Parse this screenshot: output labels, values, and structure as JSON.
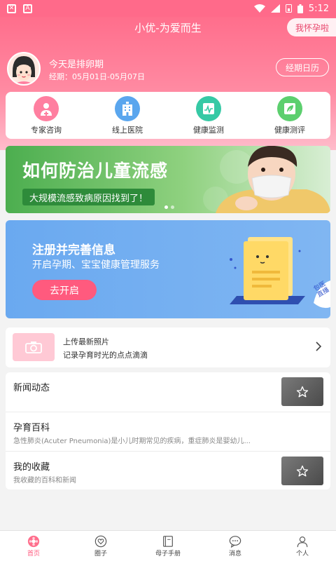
{
  "status_bar": {
    "time": "5:12",
    "icons": [
      "notification-x-icon",
      "notification-a-icon",
      "wifi-icon",
      "signal-icon",
      "sim-icon",
      "battery-icon"
    ]
  },
  "header": {
    "title": "小优-为爱而生",
    "pregnancy_button": "我怀孕啦",
    "period_title": "今天是排卵期",
    "period_date": "经期：05月01日-05月07日",
    "calendar_button": "经期日历"
  },
  "quick_actions": [
    {
      "label": "专家咨询",
      "icon": "doctor-icon",
      "color": "#ff7fa0"
    },
    {
      "label": "线上医院",
      "icon": "hospital-icon",
      "color": "#5aa6ee"
    },
    {
      "label": "健康监测",
      "icon": "monitor-icon",
      "color": "#36c9a5"
    },
    {
      "label": "健康测评",
      "icon": "leaf-icon",
      "color": "#5ccf6e"
    }
  ],
  "banner_flu": {
    "title": "如何防治儿童流感",
    "subtitle": "大规模流感致病原因找到了！"
  },
  "banner_register": {
    "title": "注册并完善信息",
    "subtitle": "开启孕期、宝宝健康管理服务",
    "button": "去开启",
    "badge": "包医直播"
  },
  "upload_card": {
    "title": "上传最新照片",
    "subtitle": "记录孕育时光的点点滴滴"
  },
  "list": [
    {
      "title": "新闻动态",
      "subtitle": ""
    },
    {
      "title": "孕育百科",
      "subtitle": "急性肺炎(Acuter Pneumonia)是小儿时期常见的疾病，重症肺炎是婴幼儿..."
    },
    {
      "title": "我的收藏",
      "subtitle": "我收藏的百科和新闻"
    }
  ],
  "tabbar": [
    {
      "label": "首页",
      "icon": "home-flower-icon",
      "active": true
    },
    {
      "label": "圈子",
      "icon": "heart-circle-icon",
      "active": false
    },
    {
      "label": "母子手册",
      "icon": "handbook-icon",
      "active": false
    },
    {
      "label": "消息",
      "icon": "message-icon",
      "active": false
    },
    {
      "label": "个人",
      "icon": "person-icon",
      "active": false
    }
  ],
  "colors": {
    "brand_pink": "#ff6e8c",
    "accent_pink": "#ff5a7e",
    "banner_green": "#4cae4f",
    "banner_blue": "#6aa9f0"
  }
}
